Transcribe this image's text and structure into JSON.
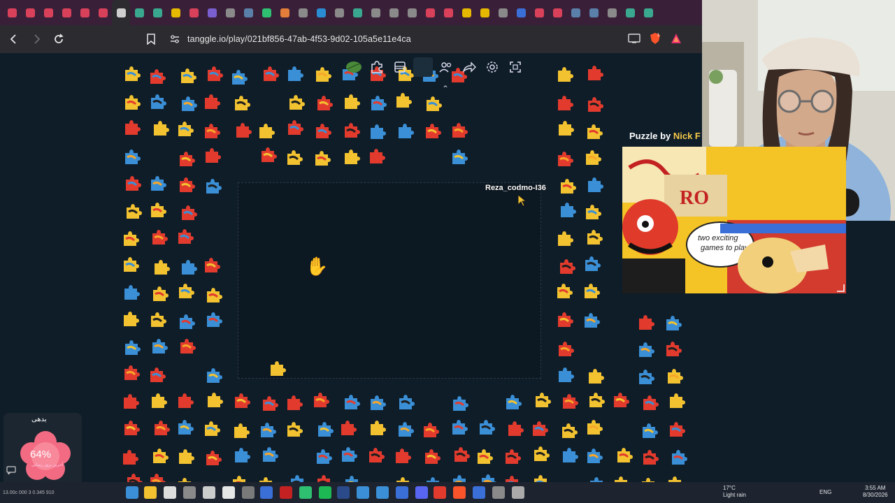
{
  "browser": {
    "url": "tanggle.io/play/021bf856-47ab-4f53-9d02-105a5e11e4ca",
    "tab_icon_colors": [
      "#d9415a",
      "#d9415a",
      "#d9415a",
      "#d9415a",
      "#d9415a",
      "#d9415a",
      "#cfcfcf",
      "#3aa88f",
      "#3aa88f",
      "#e6b800",
      "#d9415a",
      "#7a5fd1",
      "#8a8a8a",
      "#5a7fa8",
      "#2fbf71",
      "#e27d3a",
      "#8a8a8a",
      "#2a8dd4",
      "#8a8a8a",
      "#3aa88f",
      "#8a8a8a",
      "#8a8a8a",
      "#8a8a8a",
      "#d9415a",
      "#d9415a",
      "#e6b800",
      "#e6b800",
      "#8a8a8a",
      "#3a6fd8",
      "#d9415a",
      "#d9415a",
      "#5a7fa8",
      "#5a7fa8",
      "#8a8a8a",
      "#3aa88f",
      "#3aa88f"
    ]
  },
  "game": {
    "toolbar_icons": [
      "leaf-icon",
      "puzzle-piece-icon",
      "image-frame-icon",
      "blank-icon",
      "users-icon",
      "share-icon",
      "settings-icon",
      "fullscreen-icon"
    ],
    "collapse_glyph": "⌃",
    "player_cursor_name": "Reza_codmo-I36",
    "hand_glyph": "✋"
  },
  "overlay": {
    "puzzle_by_label": "Puzzle by ",
    "puzzle_author": "Nick F"
  },
  "widget": {
    "name": "بدهی",
    "percent": "64%",
    "subtitle": "آخرین بروز رسانی"
  },
  "taskbar": {
    "sysinfo": "13.00c 000 3 0.345 910",
    "weather_temp": "17°C",
    "weather_desc": "Light rain",
    "lang": "ENG",
    "time": "3:55 AM",
    "date": "8/30/2026"
  },
  "piece_colors": [
    "#f2c230",
    "#e23b2e",
    "#3a8fd6",
    "#f7a629",
    "#1f1f1f"
  ]
}
